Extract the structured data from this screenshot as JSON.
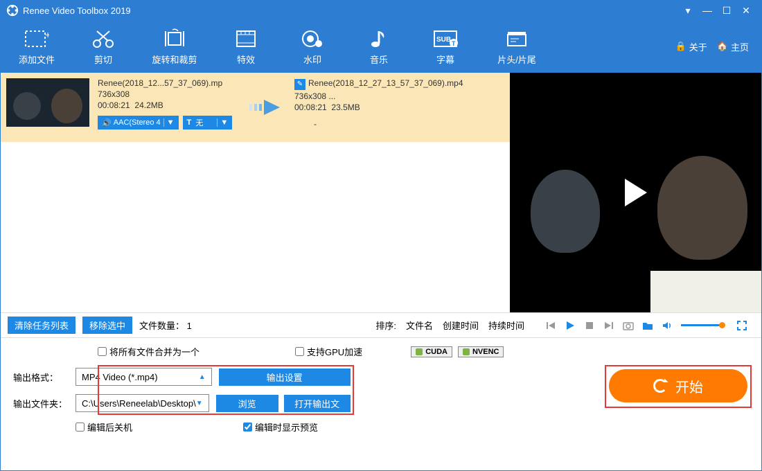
{
  "title": "Renee Video Toolbox 2019",
  "toolbar": [
    {
      "name": "add-file",
      "label": "添加文件"
    },
    {
      "name": "cut",
      "label": "剪切"
    },
    {
      "name": "rotate-crop",
      "label": "旋转和裁剪"
    },
    {
      "name": "effects",
      "label": "特效"
    },
    {
      "name": "watermark",
      "label": "水印"
    },
    {
      "name": "music",
      "label": "音乐"
    },
    {
      "name": "subtitle",
      "label": "字幕"
    },
    {
      "name": "intro-outro",
      "label": "片头/片尾"
    }
  ],
  "links": {
    "about": "关于",
    "home": "主页"
  },
  "task": {
    "src": {
      "name": "Renee(2018_12...57_37_069).mp",
      "res": "736x308",
      "dur": "00:08:21",
      "size": "24.2MB"
    },
    "dst": {
      "name": "Renee(2018_12_27_13_57_37_069).mp4",
      "res": "736x308",
      "dur": "00:08:21",
      "size": "23.5MB",
      "dots": "   ..."
    },
    "audio_pill": "AAC(Stereo 4",
    "sub_pill": "无",
    "dash": "-"
  },
  "listbar": {
    "clear": "清除任务列表",
    "remove": "移除选中",
    "count_label": "文件数量：",
    "count": "1",
    "sort_label": "排序:",
    "sort_opts": [
      "文件名",
      "创建时间",
      "持续时间"
    ]
  },
  "bottom": {
    "merge": "将所有文件合并为一个",
    "gpu": "支持GPU加速",
    "cuda": "CUDA",
    "nvenc": "NVENC",
    "fmt_label": "输出格式：",
    "fmt_value": "MP4 Video (*.mp4)",
    "folder_label": "输出文件夹：",
    "folder_value": "C:\\Users\\Reneelab\\Desktop\\",
    "out_settings": "输出设置",
    "browse": "浏览",
    "open_out": "打开输出文件",
    "shutdown": "编辑后关机",
    "preview": "编辑时显示预览",
    "start": "开始"
  }
}
